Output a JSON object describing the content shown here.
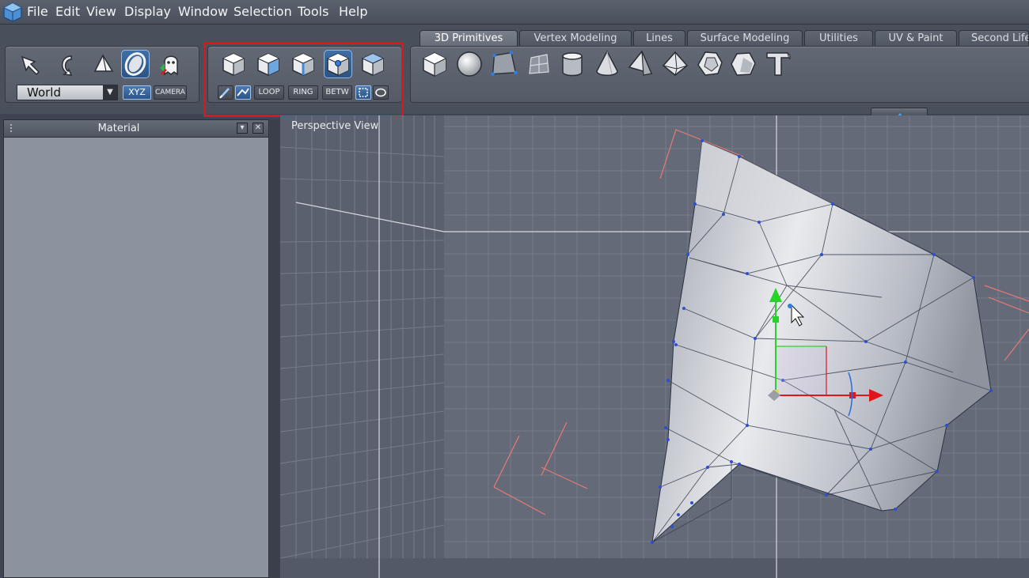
{
  "menu": {
    "items": [
      "File",
      "Edit",
      "View",
      "Display",
      "Window",
      "Selection",
      "Tools",
      "Help"
    ]
  },
  "toolbar": {
    "coord_system": "World",
    "axis_button": "XYZ",
    "camera_button": "CAMERA",
    "select_mode_buttons": [
      "LOOP",
      "RING",
      "BETW"
    ]
  },
  "tabs": [
    {
      "label": "3D Primitives",
      "active": true
    },
    {
      "label": "Vertex Modeling",
      "active": false
    },
    {
      "label": "Lines",
      "active": false
    },
    {
      "label": "Surface Modeling",
      "active": false
    },
    {
      "label": "Utilities",
      "active": false
    },
    {
      "label": "UV & Paint",
      "active": false
    },
    {
      "label": "Second Life",
      "active": false
    }
  ],
  "primitives": [
    "cube-icon",
    "sphere-icon",
    "plane-icon",
    "grid-plane-icon",
    "cylinder-icon",
    "cone-icon",
    "pyramid-icon",
    "octahedron-icon",
    "dodecahedron-icon",
    "text-3d-icon"
  ],
  "material_panel": {
    "title": "Material"
  },
  "viewport": {
    "label": "Perspective View"
  },
  "colors": {
    "highlight": "#d8181c",
    "active_button": "#2c5484",
    "gizmo_x": "#e0161a",
    "gizmo_y": "#2bd12b",
    "gizmo_z": "#2a6be0"
  }
}
